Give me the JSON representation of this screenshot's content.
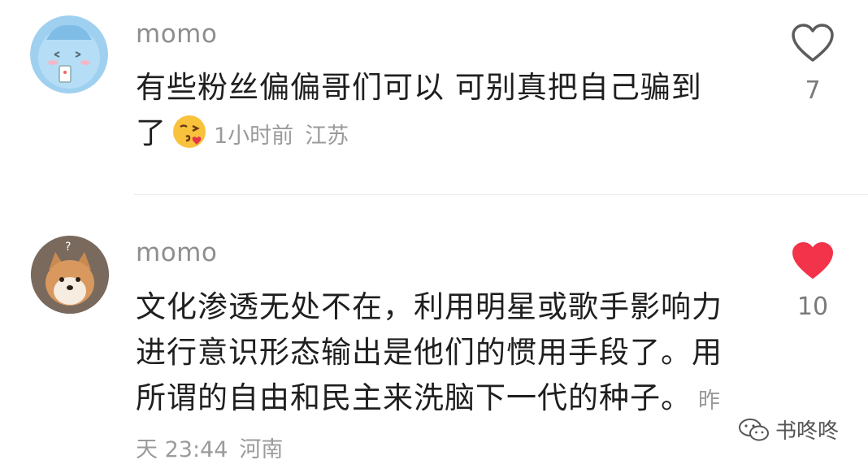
{
  "comments": [
    {
      "username": "momo",
      "text": "有些粉丝偏偏哥们可以 可别真把自己骗到了",
      "time": "1小时前",
      "location": "江苏",
      "likes": "7",
      "liked": false
    },
    {
      "username": "momo",
      "text": "文化渗透无处不在，利用明星或歌手影响力进行意识形态输出是他们的惯用手段了。用所谓的自由和民主来洗脑下一代的种子。",
      "time": "昨天 23:44",
      "location": "河南",
      "likes": "10",
      "liked": true
    }
  ],
  "watermark": {
    "text": "书咚咚"
  },
  "colors": {
    "like_active": "#f2334a",
    "meta": "#9b9b9b"
  }
}
